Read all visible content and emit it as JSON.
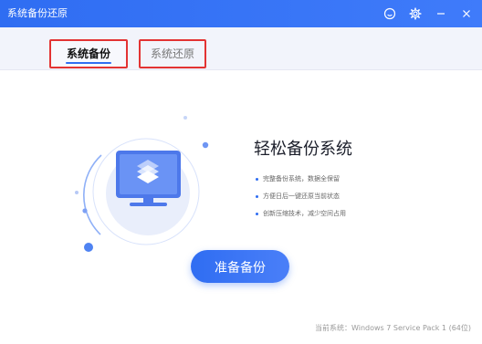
{
  "window": {
    "title": "系统备份还原",
    "controls": {
      "feedback_icon": "smile-icon",
      "settings_icon": "gear-icon",
      "minimize_icon": "minimize-icon",
      "close_icon": "close-icon"
    }
  },
  "tabs": [
    {
      "label": "系统备份",
      "active": true
    },
    {
      "label": "系统还原",
      "active": false
    }
  ],
  "hero": {
    "headline": "轻松备份系统",
    "features": [
      "完整备份系统，数据全保留",
      "方便日后一键还原当前状态",
      "创新压缩技术，减少空间占用"
    ],
    "illustration_icon": "monitor-layers-icon"
  },
  "actions": {
    "start_label": "准备备份"
  },
  "footer": {
    "system_text": "当前系统：Windows 7 Service Pack 1 (64位)"
  },
  "colors": {
    "accent": "#2f6df2",
    "highlight_border": "#e33333"
  }
}
